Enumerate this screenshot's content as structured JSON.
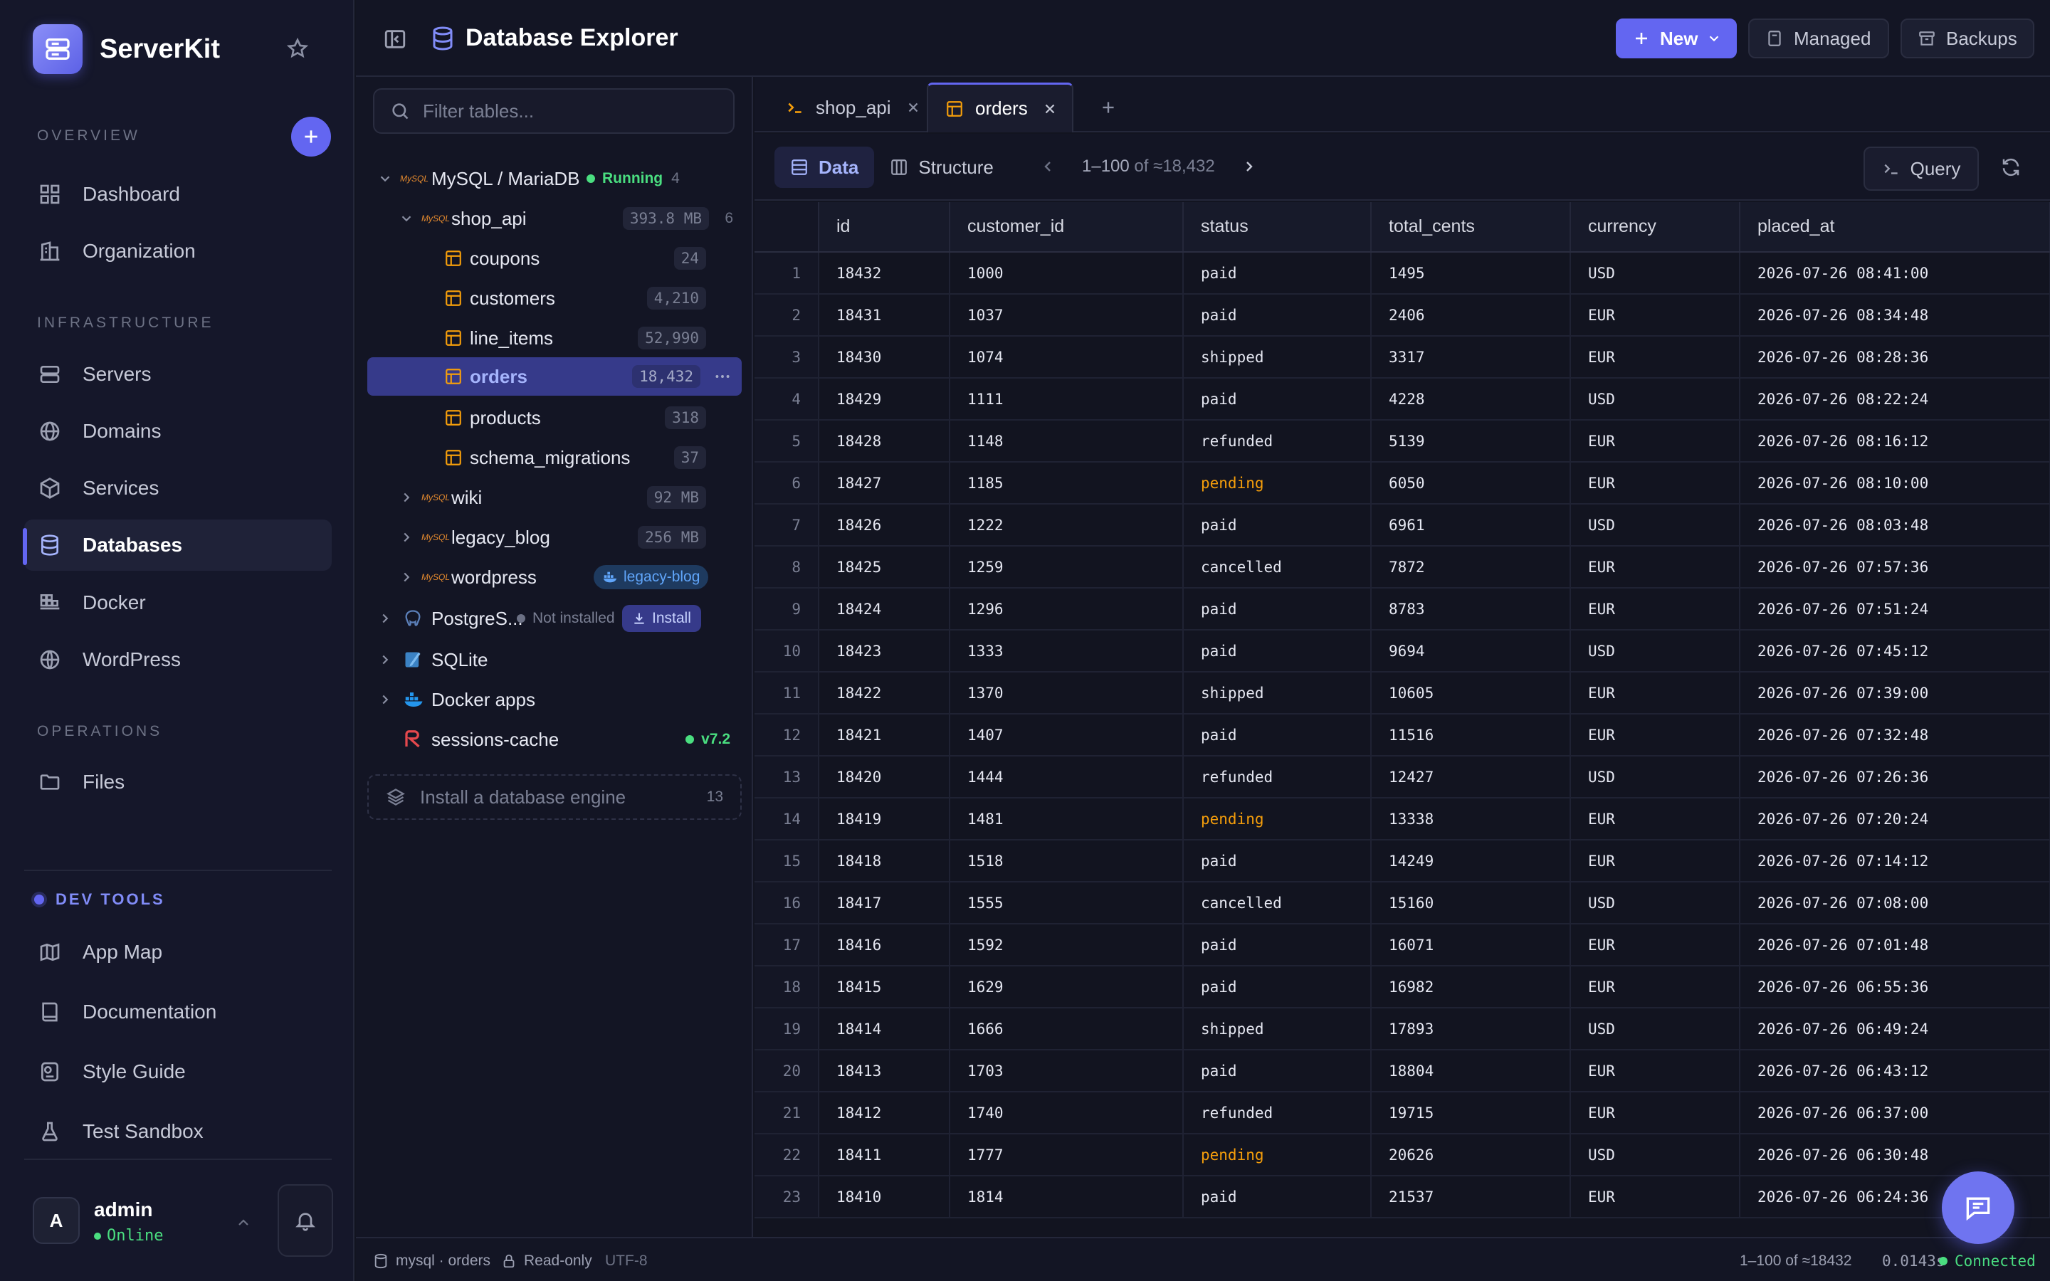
{
  "app": {
    "name": "ServerKit"
  },
  "sidebar": {
    "sections": {
      "overview": "OVERVIEW",
      "infrastructure": "INFRASTRUCTURE",
      "operations": "OPERATIONS",
      "dev_tools": "DEV TOOLS"
    },
    "overview": [
      {
        "label": "Dashboard",
        "icon": "grid-icon"
      },
      {
        "label": "Organization",
        "icon": "building-icon"
      }
    ],
    "infrastructure": [
      {
        "label": "Servers",
        "icon": "server-icon"
      },
      {
        "label": "Domains",
        "icon": "globe-icon"
      },
      {
        "label": "Services",
        "icon": "cube-icon"
      },
      {
        "label": "Databases",
        "icon": "database-icon",
        "active": true
      },
      {
        "label": "Docker",
        "icon": "docker-icon"
      },
      {
        "label": "WordPress",
        "icon": "wordpress-icon"
      }
    ],
    "operations": [
      {
        "label": "Files",
        "icon": "folder-icon"
      }
    ],
    "dev_tools": [
      {
        "label": "App Map",
        "icon": "map-icon"
      },
      {
        "label": "Documentation",
        "icon": "book-icon"
      },
      {
        "label": "Style Guide",
        "icon": "palette-icon"
      },
      {
        "label": "Test Sandbox",
        "icon": "flask-icon"
      }
    ],
    "user": {
      "initial": "A",
      "name": "admin",
      "status": "Online"
    }
  },
  "header": {
    "title": "Database Explorer",
    "new_label": "New",
    "managed_label": "Managed",
    "backups_label": "Backups"
  },
  "tree": {
    "filter_placeholder": "Filter tables...",
    "mysql": {
      "label": "MySQL / MariaDB",
      "status": "Running",
      "count": "4"
    },
    "shop_api": {
      "label": "shop_api",
      "size": "393.8 MB",
      "count": "6"
    },
    "tables": [
      {
        "label": "coupons",
        "count": "24"
      },
      {
        "label": "customers",
        "count": "4,210"
      },
      {
        "label": "line_items",
        "count": "52,990"
      },
      {
        "label": "orders",
        "count": "18,432",
        "selected": true
      },
      {
        "label": "products",
        "count": "318"
      },
      {
        "label": "schema_migrations",
        "count": "37"
      }
    ],
    "wiki": {
      "label": "wiki",
      "size": "92 MB"
    },
    "legacy_blog": {
      "label": "legacy_blog",
      "size": "256 MB"
    },
    "wordpress": {
      "label": "wordpress",
      "badge": "legacy-blog"
    },
    "postgres": {
      "label": "PostgreS...",
      "status": "Not installed",
      "install": "Install"
    },
    "sqlite": {
      "label": "SQLite"
    },
    "docker_apps": {
      "label": "Docker apps"
    },
    "sessions_cache": {
      "label": "sessions-cache",
      "version": "v7.2"
    },
    "install_engine": {
      "label": "Install a database engine",
      "count": "13"
    }
  },
  "tabs": [
    {
      "label": "shop_api",
      "icon": "terminal-icon"
    },
    {
      "label": "orders",
      "icon": "table-icon",
      "active": true
    }
  ],
  "toolbar": {
    "data_label": "Data",
    "structure_label": "Structure",
    "range": "1–100",
    "of": "of ≈18,432",
    "query_label": "Query"
  },
  "table": {
    "columns": [
      "id",
      "customer_id",
      "status",
      "total_cents",
      "currency",
      "placed_at"
    ],
    "rows": [
      [
        "1",
        "18432",
        "1000",
        "paid",
        "1495",
        "USD",
        "2026-07-26 08:41:00"
      ],
      [
        "2",
        "18431",
        "1037",
        "paid",
        "2406",
        "EUR",
        "2026-07-26 08:34:48"
      ],
      [
        "3",
        "18430",
        "1074",
        "shipped",
        "3317",
        "EUR",
        "2026-07-26 08:28:36"
      ],
      [
        "4",
        "18429",
        "1111",
        "paid",
        "4228",
        "USD",
        "2026-07-26 08:22:24"
      ],
      [
        "5",
        "18428",
        "1148",
        "refunded",
        "5139",
        "EUR",
        "2026-07-26 08:16:12"
      ],
      [
        "6",
        "18427",
        "1185",
        "pending",
        "6050",
        "EUR",
        "2026-07-26 08:10:00"
      ],
      [
        "7",
        "18426",
        "1222",
        "paid",
        "6961",
        "USD",
        "2026-07-26 08:03:48"
      ],
      [
        "8",
        "18425",
        "1259",
        "cancelled",
        "7872",
        "EUR",
        "2026-07-26 07:57:36"
      ],
      [
        "9",
        "18424",
        "1296",
        "paid",
        "8783",
        "EUR",
        "2026-07-26 07:51:24"
      ],
      [
        "10",
        "18423",
        "1333",
        "paid",
        "9694",
        "USD",
        "2026-07-26 07:45:12"
      ],
      [
        "11",
        "18422",
        "1370",
        "shipped",
        "10605",
        "EUR",
        "2026-07-26 07:39:00"
      ],
      [
        "12",
        "18421",
        "1407",
        "paid",
        "11516",
        "EUR",
        "2026-07-26 07:32:48"
      ],
      [
        "13",
        "18420",
        "1444",
        "refunded",
        "12427",
        "USD",
        "2026-07-26 07:26:36"
      ],
      [
        "14",
        "18419",
        "1481",
        "pending",
        "13338",
        "EUR",
        "2026-07-26 07:20:24"
      ],
      [
        "15",
        "18418",
        "1518",
        "paid",
        "14249",
        "EUR",
        "2026-07-26 07:14:12"
      ],
      [
        "16",
        "18417",
        "1555",
        "cancelled",
        "15160",
        "USD",
        "2026-07-26 07:08:00"
      ],
      [
        "17",
        "18416",
        "1592",
        "paid",
        "16071",
        "EUR",
        "2026-07-26 07:01:48"
      ],
      [
        "18",
        "18415",
        "1629",
        "paid",
        "16982",
        "EUR",
        "2026-07-26 06:55:36"
      ],
      [
        "19",
        "18414",
        "1666",
        "shipped",
        "17893",
        "USD",
        "2026-07-26 06:49:24"
      ],
      [
        "20",
        "18413",
        "1703",
        "paid",
        "18804",
        "EUR",
        "2026-07-26 06:43:12"
      ],
      [
        "21",
        "18412",
        "1740",
        "refunded",
        "19715",
        "EUR",
        "2026-07-26 06:37:00"
      ],
      [
        "22",
        "18411",
        "1777",
        "pending",
        "20626",
        "USD",
        "2026-07-26 06:30:48"
      ],
      [
        "23",
        "18410",
        "1814",
        "paid",
        "21537",
        "EUR",
        "2026-07-26 06:24:36"
      ]
    ]
  },
  "statusbar": {
    "source": "mysql · orders",
    "mode": "Read-only",
    "encoding": "UTF-8",
    "range": "1–100 of ≈18432",
    "time": "0.0143s",
    "connection": "Connected"
  },
  "colors": {
    "accent": "#6366f1",
    "running": "#4ade80",
    "pending": "#f59e0b",
    "table_icon": "#f59e0b"
  }
}
